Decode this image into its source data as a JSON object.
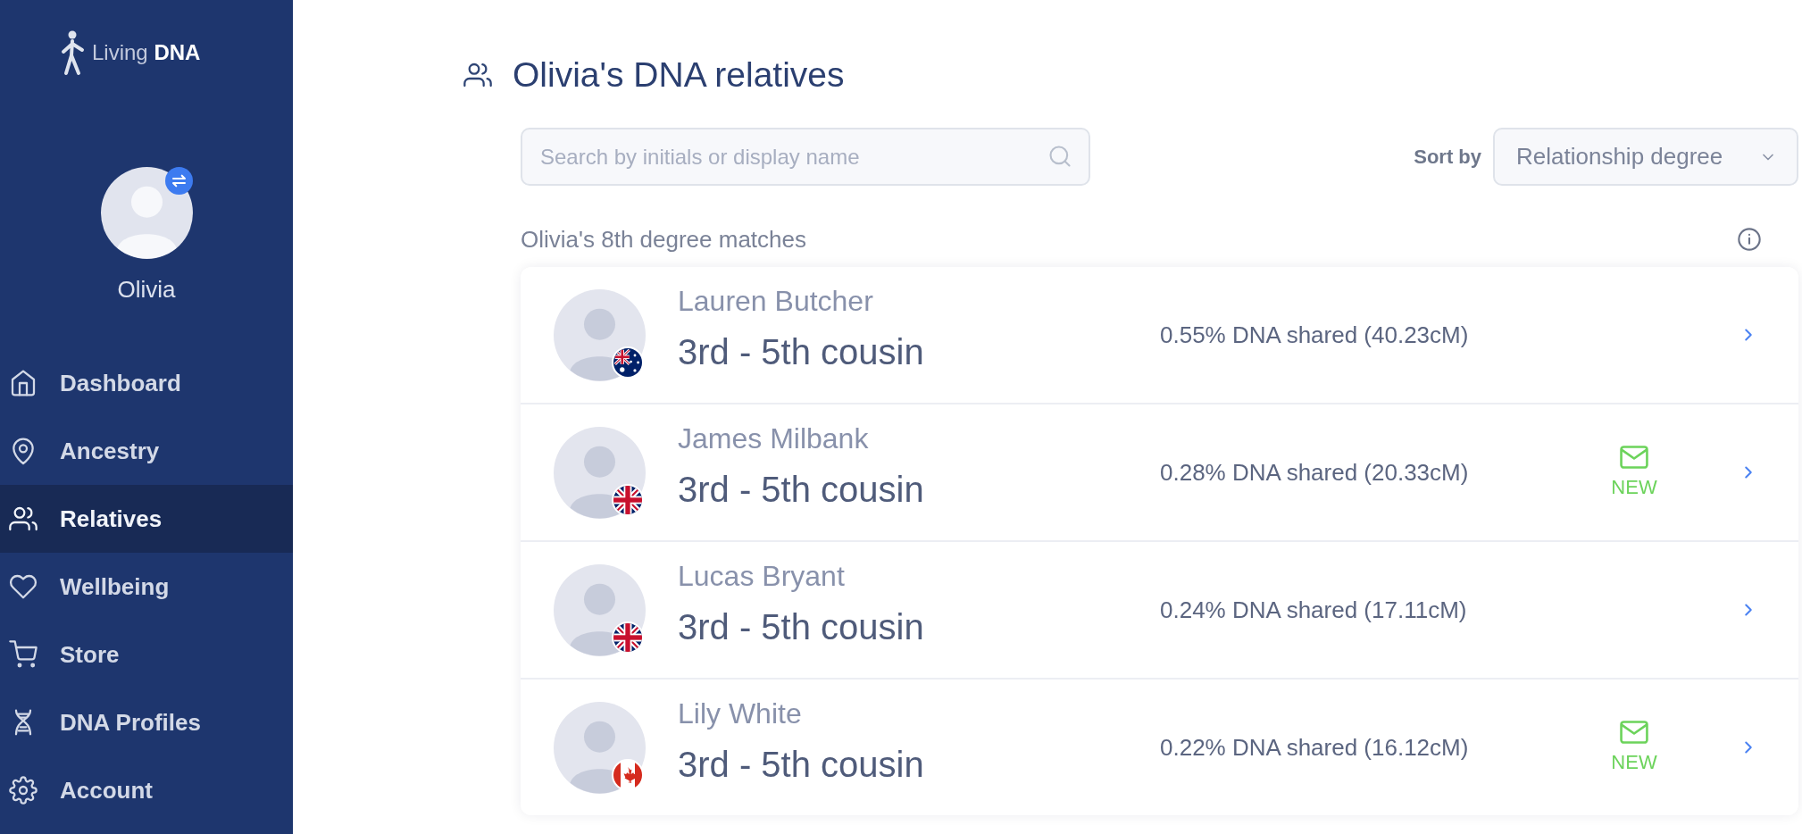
{
  "sidebar": {
    "logo": "Living **DNA**",
    "profile": {
      "name": "Olivia"
    },
    "nav": [
      {
        "label": "Dashboard",
        "selected": false
      },
      {
        "label": "Ancestry",
        "selected": false
      },
      {
        "label": "Relatives",
        "selected": true
      },
      {
        "label": "Wellbeing",
        "selected": false
      },
      {
        "label": "Store",
        "selected": false
      },
      {
        "label": "DNA Profiles",
        "selected": false
      },
      {
        "label": "Account",
        "selected": false
      }
    ]
  },
  "header": {
    "title": "Olivia's DNA relatives"
  },
  "search": {
    "placeholder": "Search by initials or display name"
  },
  "sort": {
    "label": "Sort by",
    "value": "Relationship degree"
  },
  "matches": {
    "heading": "Olivia's 8th degree matches",
    "rows": [
      {
        "name": "Lauren Butcher",
        "relationship": "3rd - 5th cousin",
        "dna_shared": "0.55% DNA shared (40.23cM)",
        "flag": {
          "kind": "australia"
        },
        "new_message": false
      },
      {
        "name": "James Milbank",
        "relationship": "3rd - 5th cousin",
        "dna_shared": "0.28% DNA shared (20.33cM)",
        "flag": {
          "kind": "united_kingdom"
        },
        "new_message": true,
        "new_label": "NEW"
      },
      {
        "name": "Lucas Bryant",
        "relationship": "3rd - 5th cousin",
        "dna_shared": "0.24% DNA shared (17.11cM)",
        "flag": {
          "kind": "united_kingdom"
        },
        "new_message": false
      },
      {
        "name": "Lily White",
        "relationship": "3rd - 5th cousin",
        "dna_shared": "0.22% DNA shared (16.12cM)",
        "flag": {
          "kind": "canada"
        },
        "new_message": true,
        "new_label": "NEW"
      }
    ]
  }
}
